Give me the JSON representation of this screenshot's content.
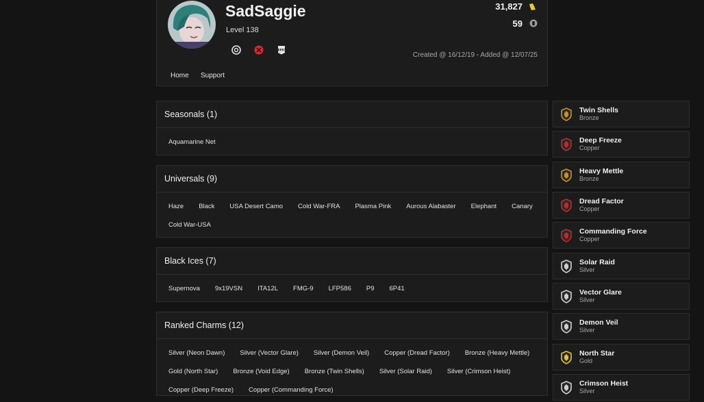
{
  "profile": {
    "username": "SadSaggie",
    "level": "Level 138",
    "stat_primary": "31,827",
    "stat_secondary": "59",
    "created": "Created @ 16/12/19 - Added @ 12/07/25",
    "platforms": [
      "ubisoft-icon",
      "xbox-icon",
      "epic-games-icon"
    ],
    "nav": [
      "Home",
      "Support"
    ]
  },
  "sections": [
    {
      "title": "Seasonals (1)",
      "items": [
        "Aquamarine Net"
      ]
    },
    {
      "title": "Universals (9)",
      "items": [
        "Haze",
        "Black",
        "USA Desert Camo",
        "Cold War-FRA",
        "Plasma Pink",
        "Aurous Alabaster",
        "Elephant",
        "Canary",
        "Cold War-USA"
      ]
    },
    {
      "title": "Black Ices (7)",
      "items": [
        "Supernova",
        "9x19VSN",
        "ITA12L",
        "FMG-9",
        "LFP586",
        "P9",
        "6P41"
      ]
    },
    {
      "title": "Ranked Charms (12)",
      "items": [
        "Silver (Neon Dawn)",
        "Silver (Vector Glare)",
        "Silver (Demon Veil)",
        "Copper (Dread Factor)",
        "Bronze (Heavy Mettle)",
        "Gold (North Star)",
        "Bronze (Void Edge)",
        "Bronze (Twin Shells)",
        "Silver (Solar Raid)",
        "Silver (Crimson Heist)",
        "Copper (Deep Freeze)",
        "Copper (Commanding Force)"
      ]
    }
  ],
  "charms": [
    {
      "name": "Twin Shells",
      "tier": "Bronze",
      "color": "#c8902a"
    },
    {
      "name": "Deep Freeze",
      "tier": "Copper",
      "color": "#c0292c"
    },
    {
      "name": "Heavy Mettle",
      "tier": "Bronze",
      "color": "#c8902a"
    },
    {
      "name": "Dread Factor",
      "tier": "Copper",
      "color": "#c0292c"
    },
    {
      "name": "Commanding Force",
      "tier": "Copper",
      "color": "#c0292c"
    },
    {
      "name": "Solar Raid",
      "tier": "Silver",
      "color": "#cfcfcf"
    },
    {
      "name": "Vector Glare",
      "tier": "Silver",
      "color": "#cfcfcf"
    },
    {
      "name": "Demon Veil",
      "tier": "Silver",
      "color": "#cfcfcf"
    },
    {
      "name": "North Star",
      "tier": "Gold",
      "color": "#e3c23a"
    },
    {
      "name": "Crimson Heist",
      "tier": "Silver",
      "color": "#cfcfcf"
    }
  ]
}
